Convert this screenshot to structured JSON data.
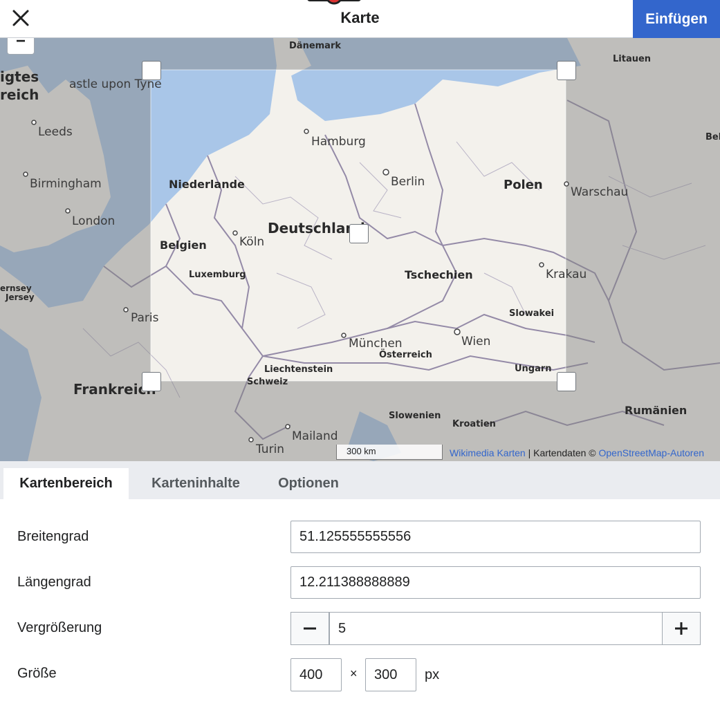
{
  "header": {
    "title": "Karte",
    "insert_label": "Einfügen"
  },
  "map": {
    "zoom_out_label": "−",
    "labels": {
      "daenemark": "Dänemark",
      "litauen": "Litauen",
      "vereinigtes_1": "igtes",
      "vereinigtes_2": "reich",
      "newcastle": "astle upon Tyne",
      "leeds": "Leeds",
      "hamburg": "Hamburg",
      "bel": "Bel",
      "birmingham": "Birmingham",
      "berlin": "Berlin",
      "niederlande": "Niederlande",
      "polen": "Polen",
      "warschau": "Warschau",
      "london": "London",
      "deutschland": "Deutschland",
      "koeln": "Köln",
      "belgien": "Belgien",
      "luxemburg": "Luxemburg",
      "tschechien": "Tschechien",
      "krakau": "Krakau",
      "jersey_1": "ernsey",
      "jersey_2": "Jersey",
      "paris": "Paris",
      "slowakei": "Slowakei",
      "wien": "Wien",
      "muenchen": "München",
      "oesterreich": "Österreich",
      "liechtenstein": "Liechtenstein",
      "ungarn": "Ungarn",
      "frankreich": "Frankreich",
      "schweiz": "Schweiz",
      "rumaenien": "Rumänien",
      "slowenien": "Slowenien",
      "kroatien": "Kroatien",
      "mailand": "Mailand",
      "turin": "Turin"
    },
    "scale_label": "300 km",
    "attribution": {
      "wikimedia": "Wikimedia Karten",
      "sep": " | Kartendaten © ",
      "osm": "OpenStreetMap-Autoren"
    }
  },
  "tabs": [
    {
      "label": "Kartenbereich"
    },
    {
      "label": "Karteninhalte"
    },
    {
      "label": "Optionen"
    }
  ],
  "form": {
    "latitude_label": "Breitengrad",
    "latitude_value": "51.125555555556",
    "longitude_label": "Längengrad",
    "longitude_value": "12.211388888889",
    "zoom_label": "Vergrößerung",
    "zoom_value": "5",
    "size_label": "Größe",
    "width_value": "400",
    "times": "×",
    "height_value": "300",
    "unit": "px"
  },
  "colors": {
    "accent": "#3366cc",
    "water": "#a9c6e8",
    "land": "#f5f3ef",
    "overlay": "#8e8e8e",
    "border": "#8a7fa0"
  }
}
